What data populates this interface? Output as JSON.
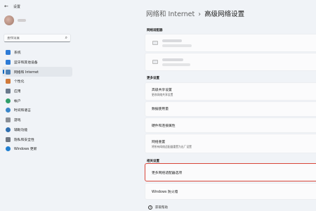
{
  "window": {
    "app_title": "设置",
    "back_icon": "back-arrow-icon"
  },
  "sidebar": {
    "search_placeholder": "查找设置",
    "items": [
      {
        "label": "系统",
        "icon": "system-icon",
        "color": "#2d7bd6",
        "active": false
      },
      {
        "label": "蓝牙和其他设备",
        "icon": "bluetooth-icon",
        "color": "#2d7bd6",
        "active": false
      },
      {
        "label": "网络和 Internet",
        "icon": "network-icon",
        "color": "#4a7fb5",
        "active": true
      },
      {
        "label": "个性化",
        "icon": "personalization-icon",
        "color": "#d07a3a",
        "active": false
      },
      {
        "label": "应用",
        "icon": "apps-icon",
        "color": "#6b7a8c",
        "active": false
      },
      {
        "label": "帐户",
        "icon": "accounts-icon",
        "color": "#2f9e6a",
        "active": false
      },
      {
        "label": "时间和语言",
        "icon": "time-language-icon",
        "color": "#3a86c9",
        "active": false
      },
      {
        "label": "游戏",
        "icon": "gaming-icon",
        "color": "#8a8f96",
        "active": false
      },
      {
        "label": "辅助功能",
        "icon": "accessibility-icon",
        "color": "#2f6fb0",
        "active": false
      },
      {
        "label": "隐私和安全性",
        "icon": "privacy-icon",
        "color": "#6f7782",
        "active": false
      },
      {
        "label": "Windows 更新",
        "icon": "windows-update-icon",
        "color": "#1f7fd1",
        "active": false
      }
    ]
  },
  "main": {
    "breadcrumb": {
      "parent": "网络和 Internet",
      "separator": "›",
      "current": "高级网络设置"
    },
    "network_adapters": {
      "label": "网络适配器"
    },
    "more_settings": {
      "label": "更多设置",
      "items": [
        {
          "title": "高级共享设置",
          "subtitle": "更改网络共享设置"
        },
        {
          "title": "数据使用量",
          "subtitle": ""
        },
        {
          "title": "硬件和连接属性",
          "subtitle": ""
        },
        {
          "title": "网络重置",
          "subtitle": "将所有网络适配器重置为出厂设置"
        }
      ]
    },
    "related_settings": {
      "label": "相关设置",
      "items": [
        {
          "title": "更多网络适配器选项"
        },
        {
          "title": "Windows 防火墙"
        }
      ]
    },
    "help": {
      "label": "获取帮助",
      "icon": "help-icon"
    },
    "highlight_color": "#d9463a"
  }
}
